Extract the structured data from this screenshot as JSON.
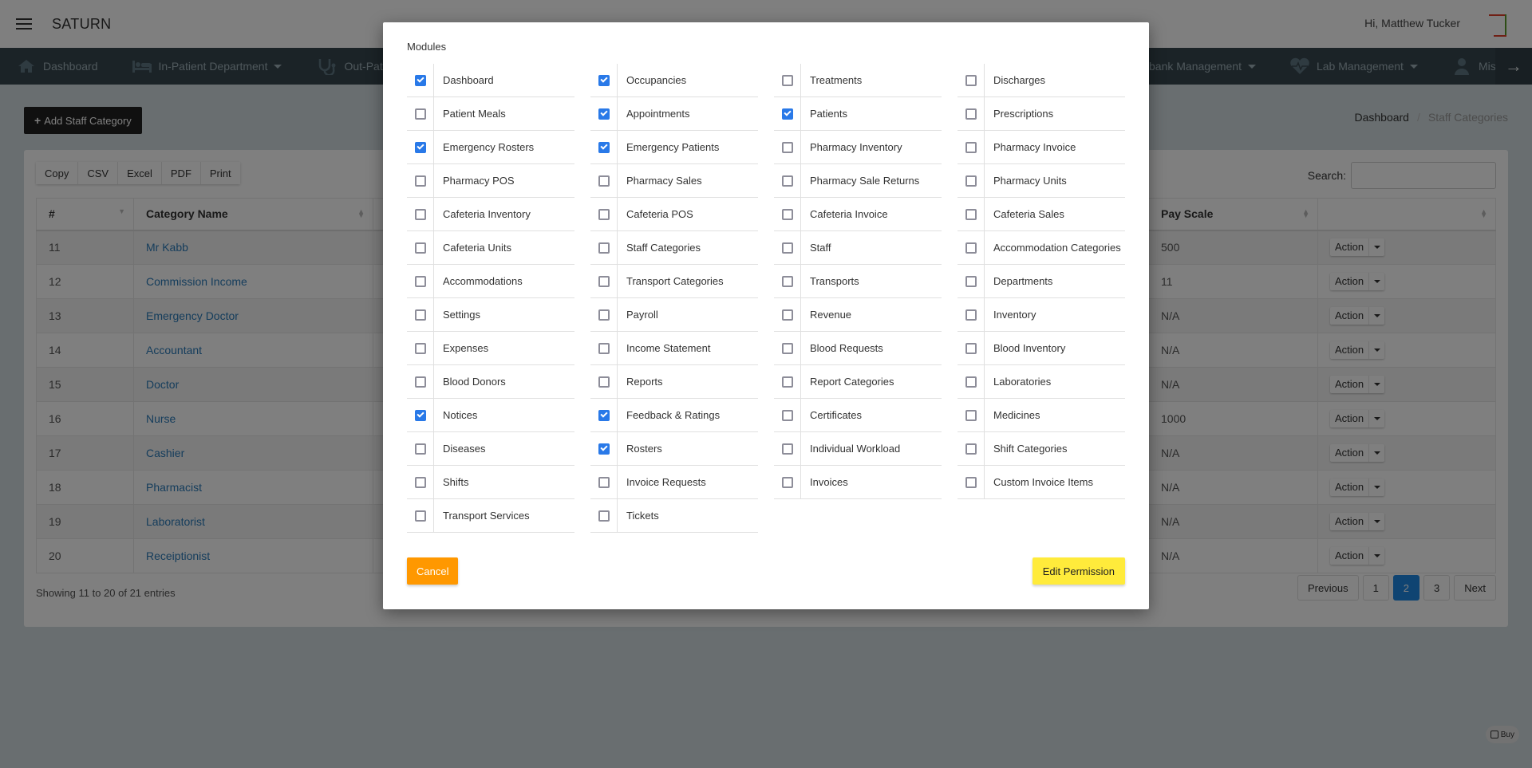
{
  "header": {
    "app_name": "SATURN",
    "greeting": "Hi, Matthew Tucker"
  },
  "nav": {
    "items": [
      {
        "label": "Dashboard",
        "icon": "home-icon",
        "has_caret": false
      },
      {
        "label": "In-Patient Department",
        "icon": "bed-icon",
        "has_caret": true
      },
      {
        "label": "Out-Patient Department",
        "icon": "stethoscope-icon",
        "has_caret": true
      },
      {
        "label": "Blood bank Management",
        "icon": "blood-icon",
        "has_caret": true
      },
      {
        "label": "Lab Management",
        "icon": "heartbeat-icon",
        "has_caret": true
      },
      {
        "label": "Miscellaneous",
        "icon": "doctor-icon",
        "has_caret": true
      }
    ],
    "visible_labels": [
      "Dashboard",
      "In-Patient Department",
      "Out-Patient D",
      "bank Management",
      "Lab Management",
      "Miscell"
    ],
    "scroll_arrow": "→"
  },
  "page": {
    "add_button": "Add Staff Category",
    "breadcrumb": [
      "Dashboard",
      "Staff Categories"
    ],
    "export_buttons": [
      "Copy",
      "CSV",
      "Excel",
      "PDF",
      "Print"
    ],
    "search_label": "Search:",
    "search_value": "",
    "table": {
      "columns": [
        "#",
        "Category Name",
        "",
        "Pay Scale",
        ""
      ],
      "rows": [
        {
          "num": "11",
          "name": "Mr Kabb",
          "pay": "500",
          "action": "Action"
        },
        {
          "num": "12",
          "name": "Commission Income",
          "pay": "11",
          "action": "Action"
        },
        {
          "num": "13",
          "name": "Emergency Doctor",
          "pay": "N/A",
          "action": "Action"
        },
        {
          "num": "14",
          "name": "Accountant",
          "pay": "N/A",
          "action": "Action"
        },
        {
          "num": "15",
          "name": "Doctor",
          "pay": "N/A",
          "action": "Action"
        },
        {
          "num": "16",
          "name": "Nurse",
          "pay": "1000",
          "action": "Action"
        },
        {
          "num": "17",
          "name": "Cashier",
          "pay": "N/A",
          "action": "Action"
        },
        {
          "num": "18",
          "name": "Pharmacist",
          "pay": "N/A",
          "action": "Action"
        },
        {
          "num": "19",
          "name": "Laboratorist",
          "pay": "N/A",
          "action": "Action"
        },
        {
          "num": "20",
          "name": "Receiptionist",
          "pay": "N/A",
          "action": "Action"
        }
      ]
    },
    "info": "Showing 11 to 20 of 21 entries",
    "pagination": {
      "previous": "Previous",
      "pages": [
        "1",
        "2",
        "3"
      ],
      "current": "2",
      "next": "Next"
    },
    "buy_badge": "Buy"
  },
  "modal": {
    "title": "Modules",
    "columns": [
      [
        {
          "label": "Dashboard",
          "checked": true
        },
        {
          "label": "Patient Meals",
          "checked": false
        },
        {
          "label": "Emergency Rosters",
          "checked": true
        },
        {
          "label": "Pharmacy POS",
          "checked": false
        },
        {
          "label": "Cafeteria Inventory",
          "checked": false
        },
        {
          "label": "Cafeteria Units",
          "checked": false
        },
        {
          "label": "Accommodations",
          "checked": false
        },
        {
          "label": "Settings",
          "checked": false
        },
        {
          "label": "Expenses",
          "checked": false
        },
        {
          "label": "Blood Donors",
          "checked": false
        },
        {
          "label": "Notices",
          "checked": true
        },
        {
          "label": "Diseases",
          "checked": false
        },
        {
          "label": "Shifts",
          "checked": false
        },
        {
          "label": "Transport Services",
          "checked": false
        }
      ],
      [
        {
          "label": "Occupancies",
          "checked": true
        },
        {
          "label": "Appointments",
          "checked": true
        },
        {
          "label": "Emergency Patients",
          "checked": true
        },
        {
          "label": "Pharmacy Sales",
          "checked": false
        },
        {
          "label": "Cafeteria POS",
          "checked": false
        },
        {
          "label": "Staff Categories",
          "checked": false
        },
        {
          "label": "Transport Categories",
          "checked": false
        },
        {
          "label": "Payroll",
          "checked": false
        },
        {
          "label": "Income Statement",
          "checked": false
        },
        {
          "label": "Reports",
          "checked": false
        },
        {
          "label": "Feedback & Ratings",
          "checked": true
        },
        {
          "label": "Rosters",
          "checked": true
        },
        {
          "label": "Invoice Requests",
          "checked": false
        },
        {
          "label": "Tickets",
          "checked": false
        }
      ],
      [
        {
          "label": "Treatments",
          "checked": false
        },
        {
          "label": "Patients",
          "checked": true
        },
        {
          "label": "Pharmacy Inventory",
          "checked": false
        },
        {
          "label": "Pharmacy Sale Returns",
          "checked": false
        },
        {
          "label": "Cafeteria Invoice",
          "checked": false
        },
        {
          "label": "Staff",
          "checked": false
        },
        {
          "label": "Transports",
          "checked": false
        },
        {
          "label": "Revenue",
          "checked": false
        },
        {
          "label": "Blood Requests",
          "checked": false
        },
        {
          "label": "Report Categories",
          "checked": false
        },
        {
          "label": "Certificates",
          "checked": false
        },
        {
          "label": "Individual Workload",
          "checked": false
        },
        {
          "label": "Invoices",
          "checked": false
        }
      ],
      [
        {
          "label": "Discharges",
          "checked": false
        },
        {
          "label": "Prescriptions",
          "checked": false
        },
        {
          "label": "Pharmacy Invoice",
          "checked": false
        },
        {
          "label": "Pharmacy Units",
          "checked": false
        },
        {
          "label": "Cafeteria Sales",
          "checked": false
        },
        {
          "label": "Accommodation Categories",
          "checked": false
        },
        {
          "label": "Departments",
          "checked": false
        },
        {
          "label": "Inventory",
          "checked": false
        },
        {
          "label": "Blood Inventory",
          "checked": false
        },
        {
          "label": "Laboratories",
          "checked": false
        },
        {
          "label": "Medicines",
          "checked": false
        },
        {
          "label": "Shift Categories",
          "checked": false
        },
        {
          "label": "Custom Invoice Items",
          "checked": false
        }
      ]
    ],
    "cancel_label": "Cancel",
    "submit_label": "Edit Permission"
  },
  "colors": {
    "accent_blue": "#1e88e5",
    "checkbox_blue": "#2979e8",
    "cancel_orange": "#ff9800",
    "submit_yellow": "#ffeb3b",
    "link_blue": "#2a7ab8",
    "nav_bg": "#37474f"
  }
}
